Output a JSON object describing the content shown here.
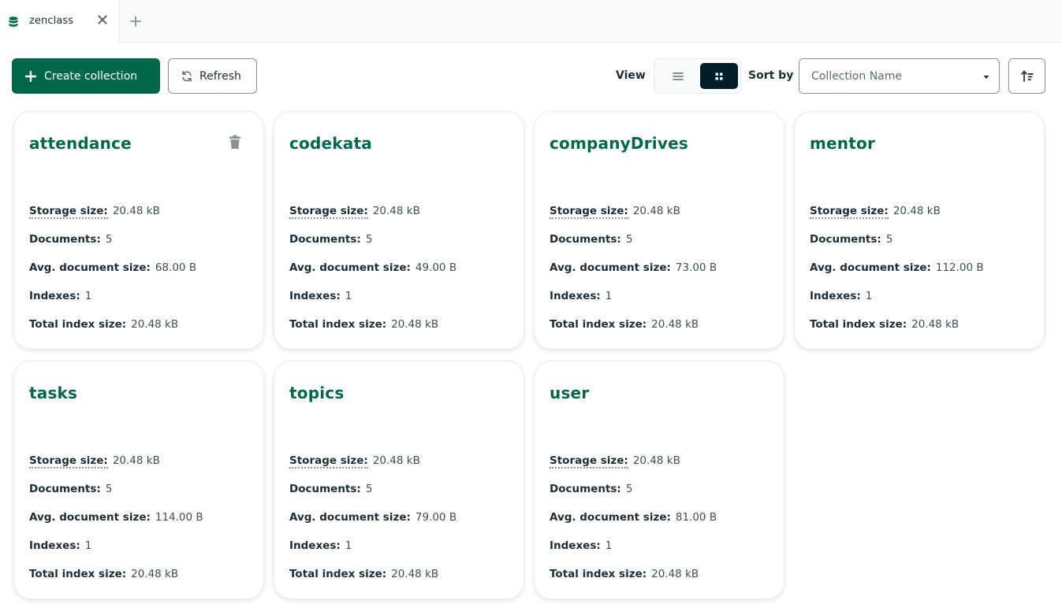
{
  "tab": {
    "label": "zenclass"
  },
  "toolbar": {
    "create_label": "Create collection",
    "refresh_label": "Refresh",
    "view_label": "View",
    "sort_label": "Sort by",
    "sort_value": "Collection Name",
    "active_view": "grid"
  },
  "labels": {
    "storage": "Storage size:",
    "documents": "Documents:",
    "avg": "Avg. document size:",
    "indexes": "Indexes:",
    "total": "Total index size:"
  },
  "colors": {
    "brand": "#00684a",
    "dark": "#001e2b"
  },
  "collections": [
    {
      "name": "attendance",
      "storage": "20.48 kB",
      "documents": "5",
      "avg": "68.00 B",
      "indexes": "1",
      "total": "20.48 kB"
    },
    {
      "name": "codekata",
      "storage": "20.48 kB",
      "documents": "5",
      "avg": "49.00 B",
      "indexes": "1",
      "total": "20.48 kB"
    },
    {
      "name": "companyDrives",
      "storage": "20.48 kB",
      "documents": "5",
      "avg": "73.00 B",
      "indexes": "1",
      "total": "20.48 kB"
    },
    {
      "name": "mentor",
      "storage": "20.48 kB",
      "documents": "5",
      "avg": "112.00 B",
      "indexes": "1",
      "total": "20.48 kB"
    },
    {
      "name": "tasks",
      "storage": "20.48 kB",
      "documents": "5",
      "avg": "114.00 B",
      "indexes": "1",
      "total": "20.48 kB"
    },
    {
      "name": "topics",
      "storage": "20.48 kB",
      "documents": "5",
      "avg": "79.00 B",
      "indexes": "1",
      "total": "20.48 kB"
    },
    {
      "name": "user",
      "storage": "20.48 kB",
      "documents": "5",
      "avg": "81.00 B",
      "indexes": "1",
      "total": "20.48 kB"
    }
  ]
}
